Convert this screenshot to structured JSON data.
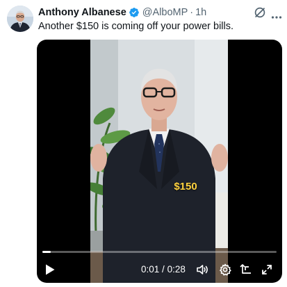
{
  "tweet": {
    "author_name": "Anthony Albanese",
    "handle": "@AlboMP",
    "separator": "·",
    "time": "1h",
    "text": "Another $150 is coming off your power bills.",
    "verified_color": "#1d9bf0"
  },
  "video": {
    "caption": "$150",
    "current_time": "0:01",
    "duration": "0:28",
    "time_separator": "/",
    "progress_fraction": 0.036
  },
  "icons": {
    "grok": "grok-icon",
    "more": "more-icon",
    "play": "play-icon",
    "volume": "volume-icon",
    "settings": "gear-icon",
    "rotate": "rotate-icon",
    "fullscreen": "fullscreen-icon"
  }
}
